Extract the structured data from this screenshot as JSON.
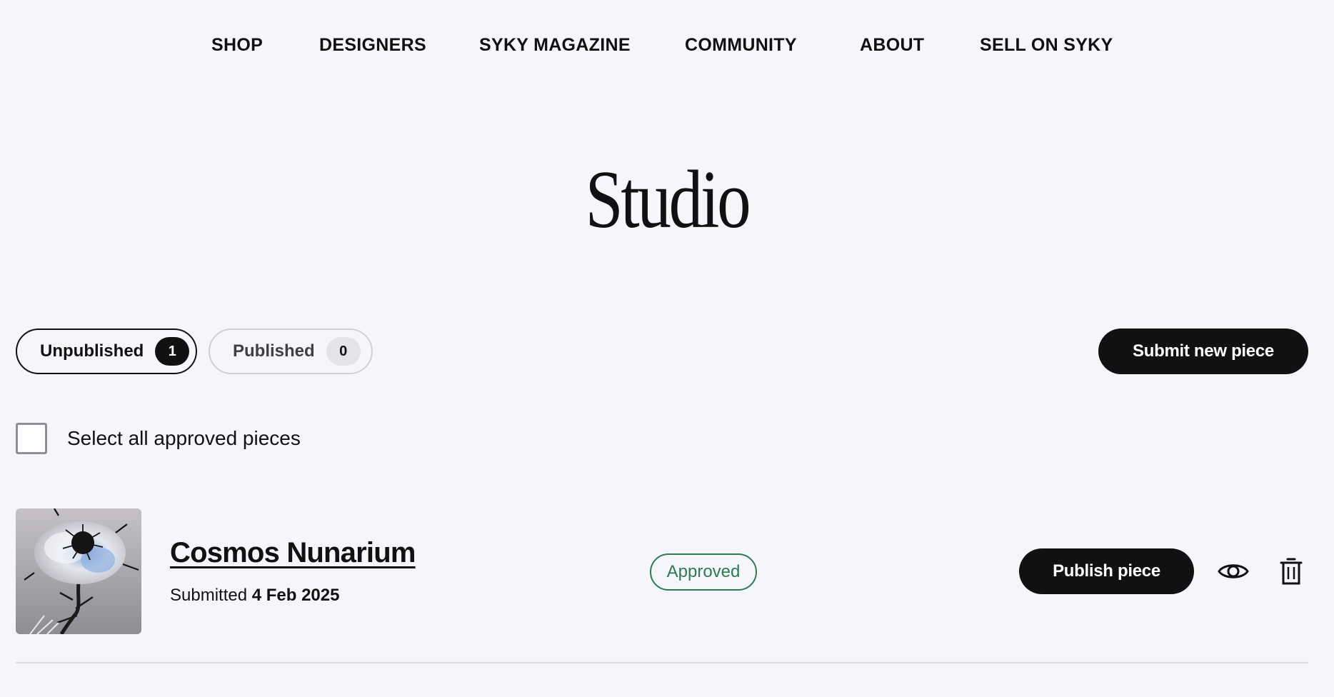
{
  "nav": {
    "items": [
      "SHOP",
      "DESIGNERS",
      "SYKY MAGAZINE",
      "COMMUNITY",
      "ABOUT",
      "SELL ON SYKY"
    ]
  },
  "page": {
    "title": "Studio"
  },
  "tabs": [
    {
      "label": "Unpublished",
      "count": "1",
      "active": true
    },
    {
      "label": "Published",
      "count": "0",
      "active": false
    }
  ],
  "toolbar": {
    "submit_label": "Submit new piece"
  },
  "select_all": {
    "label": "Select all approved pieces"
  },
  "pieces": [
    {
      "title": "Cosmos Nunarium",
      "submitted_prefix": "Submitted",
      "submitted_date": "4 Feb 2025",
      "status": "Approved",
      "publish_label": "Publish piece"
    }
  ],
  "icons": {
    "preview": "eye-icon",
    "delete": "trash-icon"
  },
  "colors": {
    "background": "#f5f6fa",
    "primary": "#111111",
    "approved": "#2f7a53"
  }
}
